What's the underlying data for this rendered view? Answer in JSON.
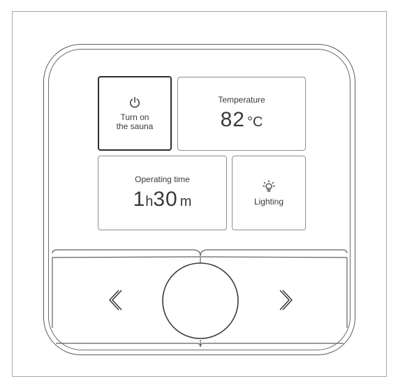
{
  "panel": {
    "power_tile": {
      "icon": "power-icon",
      "label_line1": "Turn on",
      "label_line2": "the sauna",
      "selected": true
    },
    "temperature_tile": {
      "label": "Temperature",
      "value": "82",
      "unit": "°C"
    },
    "operating_time_tile": {
      "label": "Operating time",
      "hours": "1",
      "hours_unit": "h",
      "minutes": "30",
      "minutes_unit": "m"
    },
    "lighting_tile": {
      "icon": "light-bulb-icon",
      "label": "Lighting"
    }
  },
  "controls": {
    "left_button_icon": "chevron-left-icon",
    "left_glyph": "≪",
    "center_button": "center-dial-button",
    "right_button_icon": "chevron-right-icon",
    "right_glyph": "≫"
  },
  "colors": {
    "outline": "#5a5a5a",
    "tile_border": "#8f8f8f",
    "selected_border": "#2d2d2d",
    "text": "#3a3a3a",
    "background": "#ffffff"
  }
}
